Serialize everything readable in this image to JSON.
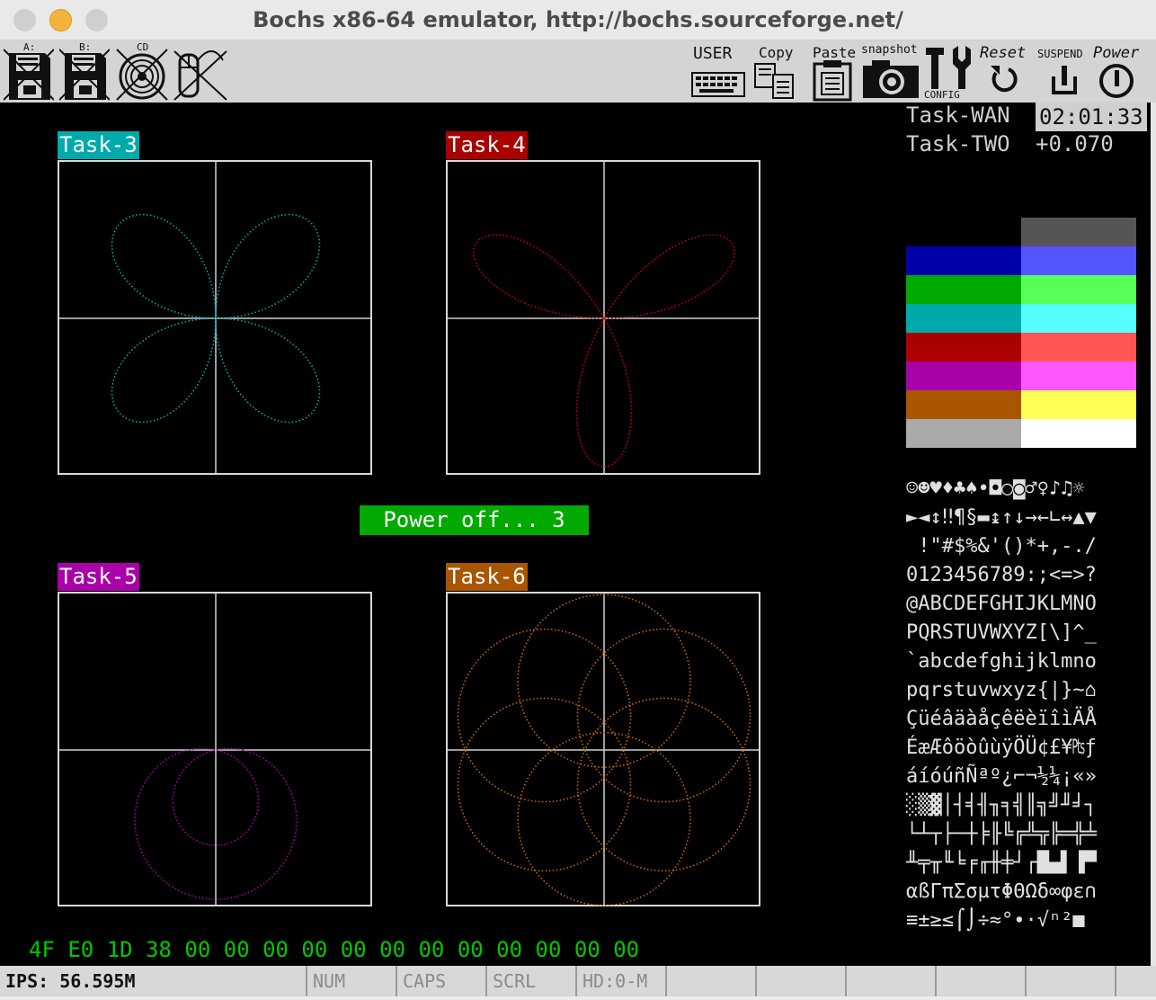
{
  "window": {
    "title": "Bochs x86-64 emulator, http://bochs.sourceforge.net/"
  },
  "toolbar": {
    "floppy_a": "A:",
    "floppy_b": "B:",
    "cdrom": "CD",
    "user": "USER",
    "copy": "Copy",
    "paste": "Paste",
    "snapshot": "snapshot",
    "config": "CONFIG",
    "reset": "Reset",
    "suspend": "SUSPEND",
    "power": "Power"
  },
  "screen": {
    "tasks": [
      {
        "label": "Task-3",
        "color": "#00aaaa",
        "curve_color": "#00aaaa"
      },
      {
        "label": "Task-4",
        "color": "#aa0000",
        "curve_color": "#cc0000"
      },
      {
        "label": "Task-5",
        "color": "#aa00aa",
        "curve_color": "#aa00aa"
      },
      {
        "label": "Task-6",
        "color": "#aa5500",
        "curve_color": "#cc6600"
      }
    ],
    "status_message": "Power off... 3",
    "task_wan_label": "Task-WAN",
    "task_wan_time": "02:01:33",
    "task_two_label": "Task-TWO",
    "task_two_value": "+0.070",
    "palette": [
      [
        "#000000",
        "#555555"
      ],
      [
        "#0000aa",
        "#5555ff"
      ],
      [
        "#00aa00",
        "#55ff55"
      ],
      [
        "#00aaaa",
        "#55ffff"
      ],
      [
        "#aa0000",
        "#ff5555"
      ],
      [
        "#aa00aa",
        "#ff55ff"
      ],
      [
        "#aa5500",
        "#ffff55"
      ],
      [
        "#aaaaaa",
        "#ffffff"
      ]
    ],
    "charset_lines": [
      "☺☻♥♦♣♠•◘○◙♂♀♪♫☼",
      "►◄↕‼¶§▬↨↑↓→←∟↔▲▼",
      " !\"#$%&'()*+,-./",
      "0123456789:;<=>?",
      "@ABCDEFGHIJKLMNO",
      "PQRSTUVWXYZ[\\]^_",
      "`abcdefghijklmno",
      "pqrstuvwxyz{|}~⌂",
      "ÇüéâäàåçêëèïîìÄÅ",
      "ÉæÆôöòûùÿÖÜ¢£¥₧ƒ",
      "áíóúñÑªº¿⌐¬½¼¡«»",
      "░▒▓│┤╡╢╖╕╣║╗╝╜╛┐",
      "└┴┬├─┼╞╟╚╔╩╦╠═╬╧",
      "╨╤╥╙╘╒╓╫╪┘┌█▄▌▐▀",
      "αßΓπΣσµτΦΘΩδ∞φε∩",
      "≡±≥≤⌠⌡÷≈°∙·√ⁿ²■ "
    ],
    "hex_dump": "4F E0 1D 38 00 00 00 00 00 00 00 00 00 00 00 00"
  },
  "statusbar": {
    "ips": "IPS: 56.595M",
    "num": "NUM",
    "caps": "CAPS",
    "scrl": "SCRL",
    "hd": "HD:0-M"
  }
}
